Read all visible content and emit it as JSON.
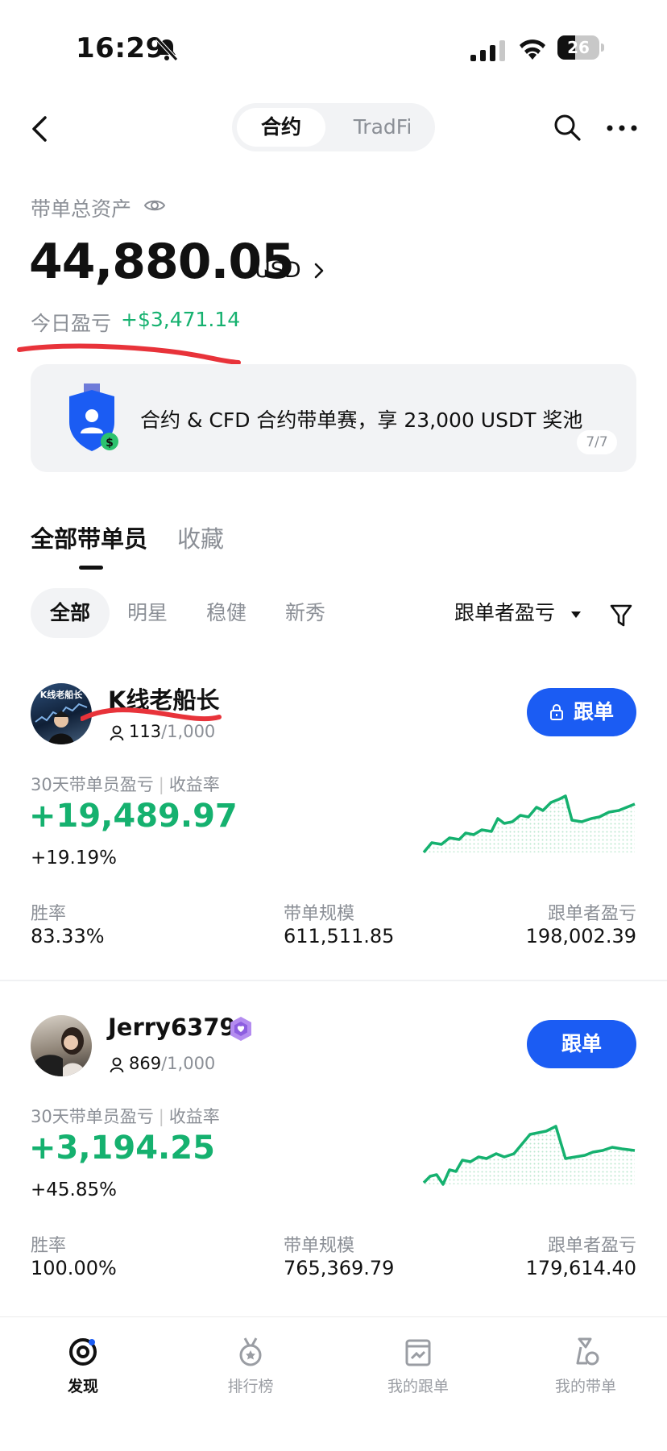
{
  "status_bar": {
    "time": "16:29",
    "battery": "26"
  },
  "top_nav": {
    "tabs": [
      "合约",
      "TradFi"
    ],
    "active_tab": "合约"
  },
  "assets": {
    "label": "带单总资产",
    "value": "44,880.05",
    "unit": "USD",
    "today_pnl_label": "今日盈亏",
    "today_pnl_value": "+$3,471.14"
  },
  "banner": {
    "text": "合约 & CFD 合约带单赛，享 23,000 USDT 奖池",
    "counter": "7/7"
  },
  "section_tabs": {
    "all": "全部带单员",
    "favorites": "收藏"
  },
  "filters": {
    "chips": [
      "全部",
      "明星",
      "稳健",
      "新秀"
    ],
    "active_chip": "全部",
    "sort_label": "跟单者盈亏"
  },
  "colors": {
    "accent": "#1b5cf3",
    "profit": "#15b16f"
  },
  "traders": [
    {
      "name": "K线老船长",
      "avatar_text": "K线老船长",
      "followers": "113",
      "capacity": "/1,000",
      "button_label": "跟单",
      "locked": true,
      "pnl30_label": "30天带单员盈亏",
      "roi_label": "收益率",
      "pnl30_value": "+19,489.97",
      "roi_value": "+19.19%",
      "stats": [
        {
          "label": "胜率",
          "value": "83.33%"
        },
        {
          "label": "带单规模",
          "value": "611,511.85"
        },
        {
          "label": "跟单者盈亏",
          "value": "198,002.39"
        }
      ]
    },
    {
      "name": "Jerry6379",
      "followers": "869",
      "capacity": "/1,000",
      "button_label": "跟单",
      "locked": false,
      "pnl30_label": "30天带单员盈亏",
      "roi_label": "收益率",
      "pnl30_value": "+3,194.25",
      "roi_value": "+45.85%",
      "stats": [
        {
          "label": "胜率",
          "value": "100.00%"
        },
        {
          "label": "带单规模",
          "value": "765,369.79"
        },
        {
          "label": "跟单者盈亏",
          "value": "179,614.40"
        }
      ]
    }
  ],
  "bottom_nav": [
    {
      "label": "发现",
      "icon": "discover-icon",
      "active": true
    },
    {
      "label": "排行榜",
      "icon": "ranking-icon",
      "active": false
    },
    {
      "label": "我的跟单",
      "icon": "my-copy-icon",
      "active": false
    },
    {
      "label": "我的带单",
      "icon": "my-lead-icon",
      "active": false
    }
  ]
}
